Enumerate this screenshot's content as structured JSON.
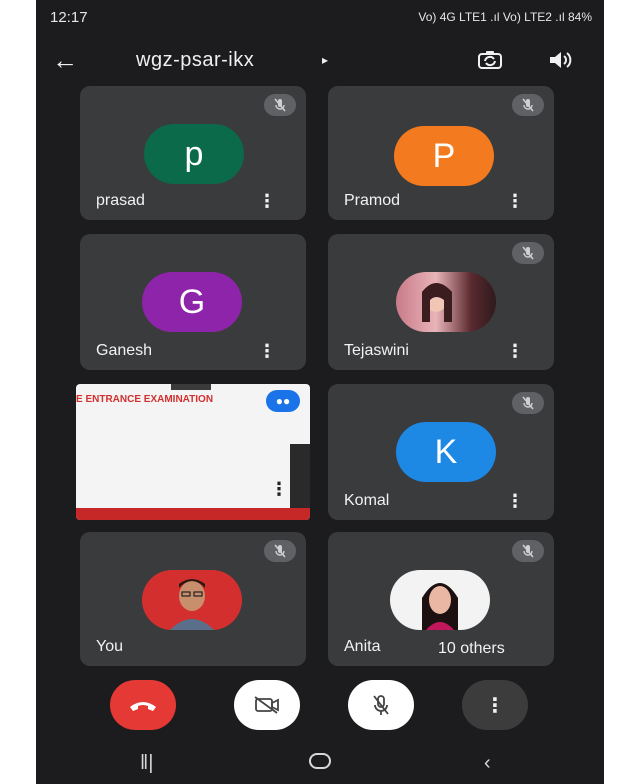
{
  "status_bar": {
    "time": "12:17",
    "system_info": "Vo) 4G LTE1 .ıl Vo) LTE2 .ıl 84%"
  },
  "header": {
    "meeting_code": "wgz-psar-ikx",
    "back_icon": "arrow-left-icon",
    "camera_switch_icon": "camera-switch-icon",
    "speaker_icon": "speaker-icon"
  },
  "participants": [
    {
      "name": "prasad",
      "initial": "p",
      "avatar_color": "#0b6a4a"
    },
    {
      "name": "Pramod",
      "initial": "P",
      "avatar_color": "#f47a1f"
    },
    {
      "name": "Ganesh",
      "initial": "G",
      "avatar_color": "#8e24aa"
    },
    {
      "name": "Tejaswini",
      "photo": true
    },
    {
      "name": "Komal",
      "initial": "K",
      "avatar_color": "#1e88e5"
    },
    {
      "name": "You",
      "photo": true
    },
    {
      "name": "Anita",
      "photo": true,
      "others_label": "10 others"
    }
  ],
  "presentation": {
    "banner_text": "E ENTRANCE EXAMINATION"
  },
  "controls": {
    "end_call_color": "#e53935",
    "button_bg": "#ffffff",
    "more_bg": "#3c3c3c"
  },
  "colors": {
    "background": "#1c1c1e",
    "tile": "#3a3b3d",
    "mute_chip": "#5f6164",
    "presenting_badge": "#1a73e8"
  }
}
